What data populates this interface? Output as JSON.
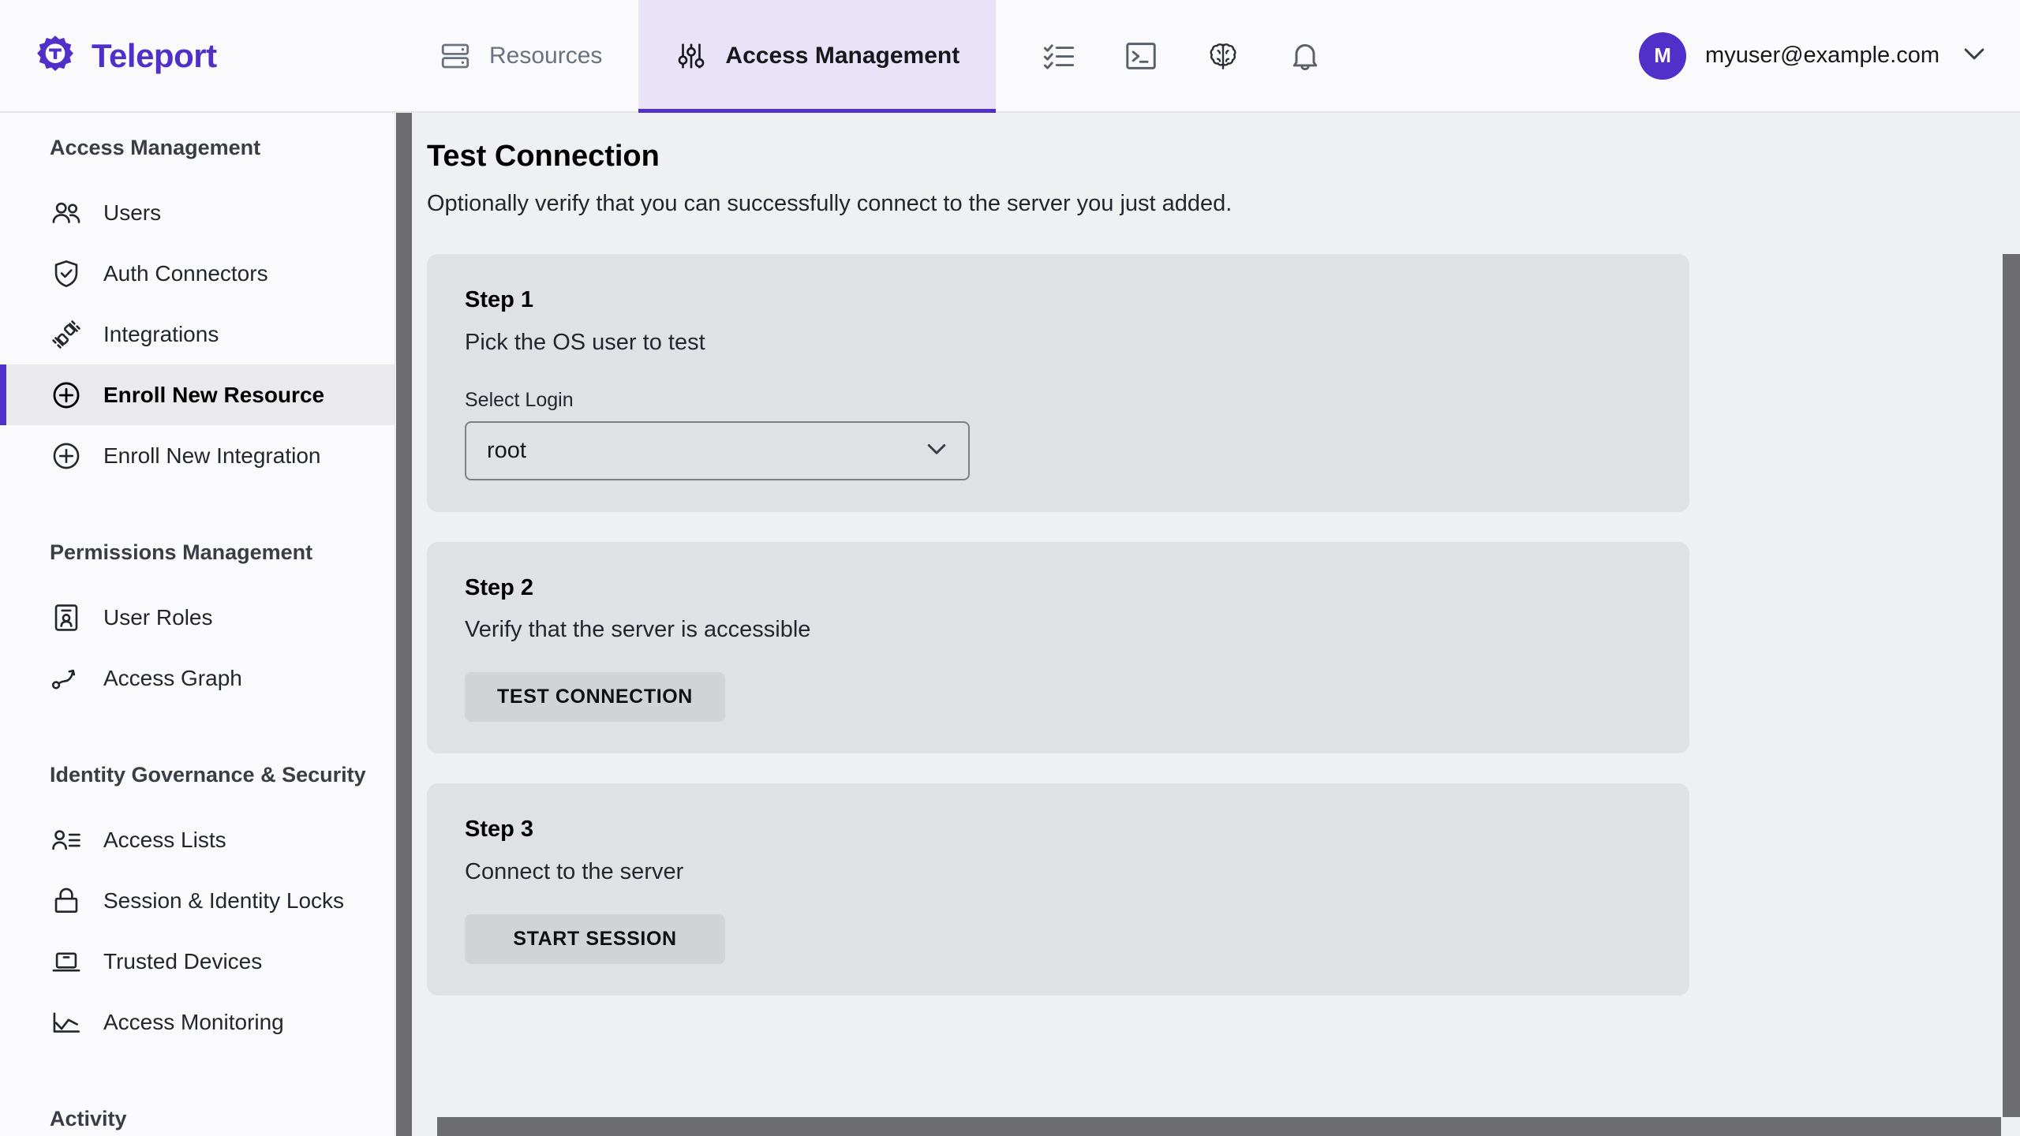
{
  "brand": {
    "name": "Teleport",
    "logo_icon": "teleport-gear-logo"
  },
  "topnav": {
    "tabs": [
      {
        "label": "Resources",
        "icon": "server-rack-icon",
        "active": false
      },
      {
        "label": "Access Management",
        "icon": "sliders-icon",
        "active": true
      }
    ],
    "tools": [
      {
        "icon": "checklist-icon",
        "name": "checklist"
      },
      {
        "icon": "terminal-icon",
        "name": "terminal"
      },
      {
        "icon": "brain-icon",
        "name": "assist"
      },
      {
        "icon": "bell-icon",
        "name": "notifications"
      }
    ],
    "user": {
      "avatar_initial": "M",
      "email": "myuser@example.com",
      "caret_icon": "chevron-down-icon",
      "avatar_color": "#512FC9"
    }
  },
  "sidebar": {
    "sections": [
      {
        "title": "Access Management",
        "items": [
          {
            "label": "Users",
            "icon": "users-icon",
            "active": false
          },
          {
            "label": "Auth Connectors",
            "icon": "shield-check-icon",
            "active": false
          },
          {
            "label": "Integrations",
            "icon": "plug-icon",
            "active": false
          },
          {
            "label": "Enroll New Resource",
            "icon": "plus-circle-icon",
            "active": true
          },
          {
            "label": "Enroll New Integration",
            "icon": "plus-circle-icon",
            "active": false
          }
        ]
      },
      {
        "title": "Permissions Management",
        "items": [
          {
            "label": "User Roles",
            "icon": "id-badge-icon",
            "active": false
          },
          {
            "label": "Access Graph",
            "icon": "graph-nodes-icon",
            "active": false
          }
        ]
      },
      {
        "title": "Identity Governance & Security",
        "items": [
          {
            "label": "Access Lists",
            "icon": "person-list-icon",
            "active": false
          },
          {
            "label": "Session & Identity Locks",
            "icon": "lock-icon",
            "active": false
          },
          {
            "label": "Trusted Devices",
            "icon": "laptop-icon",
            "active": false
          },
          {
            "label": "Access Monitoring",
            "icon": "chart-line-icon",
            "active": false
          }
        ]
      },
      {
        "title": "Activity",
        "items": []
      }
    ]
  },
  "main": {
    "title": "Test Connection",
    "subtitle": "Optionally verify that you can successfully connect to the server you just added.",
    "steps": [
      {
        "title": "Step 1",
        "description": "Pick the OS user to test",
        "field_label": "Select Login",
        "select_value": "root",
        "select_caret_icon": "chevron-down-icon"
      },
      {
        "title": "Step 2",
        "description": "Verify that the server is accessible",
        "button_label": "TEST CONNECTION"
      },
      {
        "title": "Step 3",
        "description": "Connect to the server",
        "button_label": "START SESSION"
      }
    ]
  },
  "colors": {
    "brand_purple": "#512FC9",
    "active_tab_bg": "#E8E3F8",
    "card_bg": "#E0E1E4",
    "main_bg": "#EFF0F2",
    "button_bg": "#D2D3D6",
    "scrollbar": "#6C6C70"
  }
}
